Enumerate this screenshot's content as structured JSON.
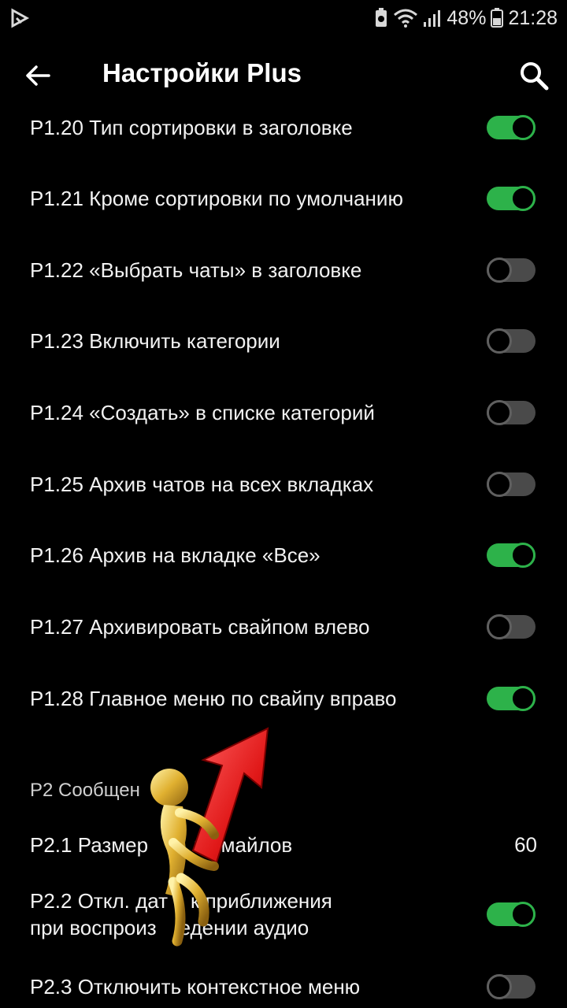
{
  "status_bar": {
    "battery_percent": "48%",
    "time": "21:28"
  },
  "appbar": {
    "title": "Настройки Plus",
    "back_icon": "arrow-back-icon",
    "search_icon": "search-icon"
  },
  "rows": [
    {
      "label": "P1.20 Тип сортировки в заголовке",
      "on": true
    },
    {
      "label": "P1.21 Кроме сортировки по умолчанию",
      "on": true
    },
    {
      "label": "P1.22 «Выбрать чаты» в заголовке",
      "on": false
    },
    {
      "label": "P1.23 Включить категории",
      "on": false
    },
    {
      "label": "P1.24 «Создать» в списке категорий",
      "on": false
    },
    {
      "label": "P1.25 Архив чатов на всех вкладках",
      "on": false
    },
    {
      "label": "P1.26 Архив на вкладке «Все»",
      "on": true
    },
    {
      "label": "P1.27 Архивировать свайпом влево",
      "on": false
    },
    {
      "label": "P1.28 Главное меню по свайпу вправо",
      "on": true
    }
  ],
  "section": {
    "title": "P2 Сообщен"
  },
  "section_rows": {
    "p21_label": "P2.1 Размер        и смайлов",
    "p21_value": "60",
    "p22_line1": "P2.2 Откл. дат    к приближения",
    "p22_line2": "при воспроиз    едении аудио",
    "p22_on": true,
    "p23_label": "P2.3 Отключить контекстное меню",
    "p23_on": false
  },
  "colors": {
    "accent": "#2db24a",
    "background": "#000000",
    "text": "#f2f2f2"
  }
}
